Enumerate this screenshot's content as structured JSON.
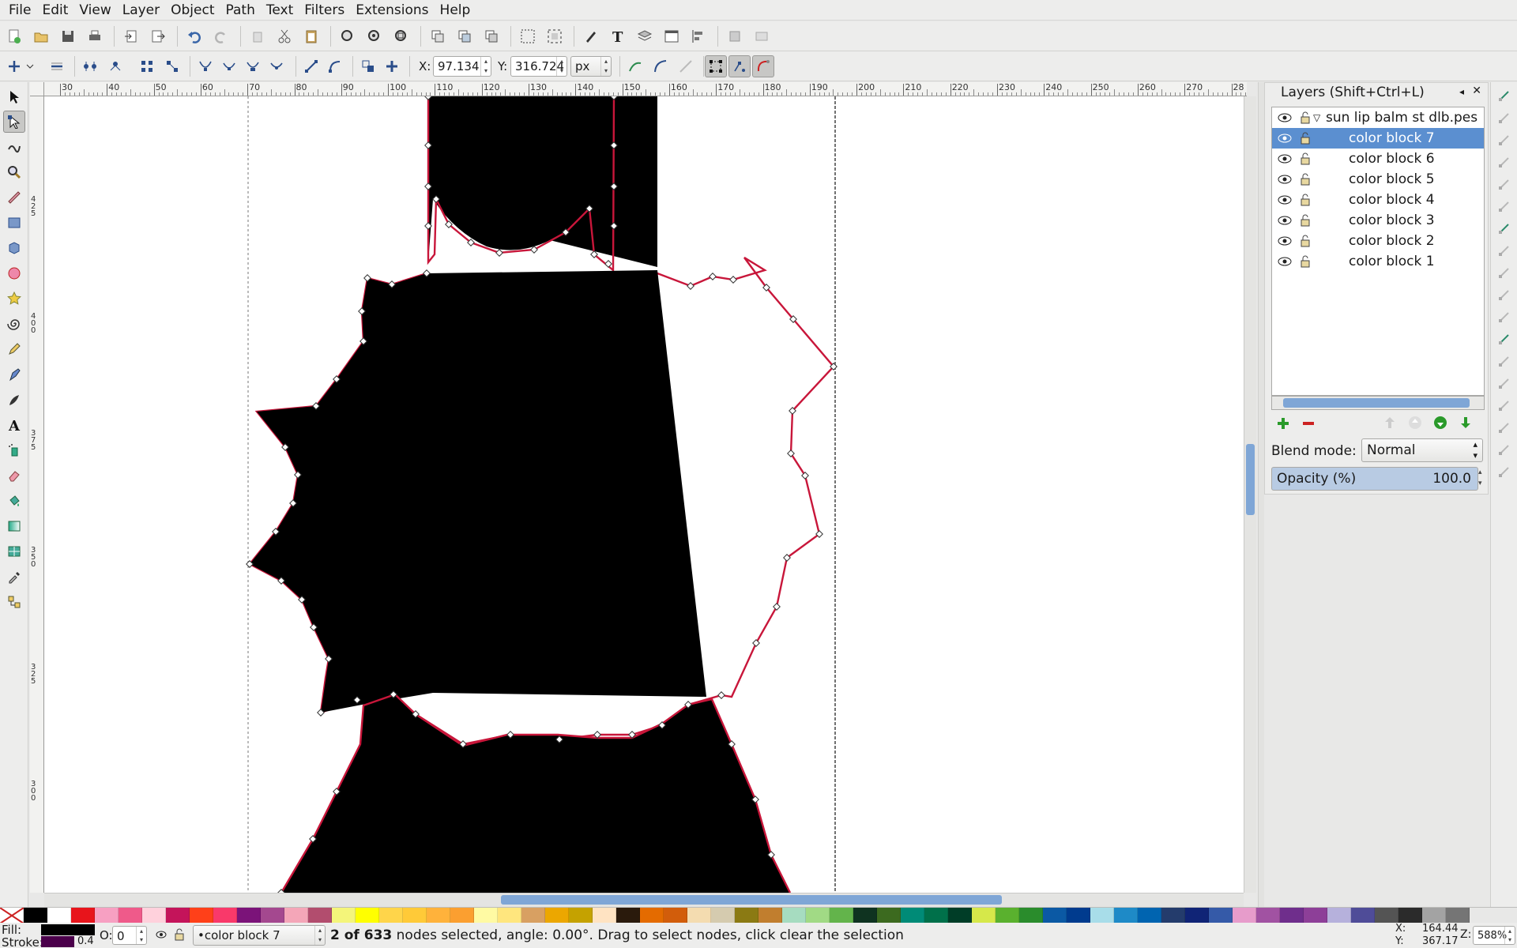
{
  "menubar": {
    "items": [
      "File",
      "Edit",
      "View",
      "Layer",
      "Object",
      "Path",
      "Text",
      "Filters",
      "Extensions",
      "Help"
    ]
  },
  "toolbar": {
    "x_label": "X:",
    "x_value": "97.134",
    "y_label": "Y:",
    "y_value": "316.724",
    "unit": "px"
  },
  "rulers": {
    "horizontal": [
      "30",
      "40",
      "50",
      "60",
      "70",
      "80",
      "90",
      "100",
      "110",
      "120",
      "130",
      "140",
      "150",
      "160",
      "170",
      "180",
      "190",
      "200",
      "210",
      "220",
      "230",
      "240",
      "250",
      "260",
      "270",
      "28"
    ],
    "vertical": [
      "425",
      "400",
      "375",
      "350",
      "325",
      "300"
    ]
  },
  "layers": {
    "title": "Layers (Shift+Ctrl+L)",
    "root": "sun lip balm st dlb.pes",
    "items": [
      "color block 7",
      "color block 6",
      "color block 5",
      "color block 4",
      "color block 3",
      "color block 2",
      "color block 1"
    ],
    "selected_index": 0,
    "blend_label": "Blend mode:",
    "blend_value": "Normal",
    "opacity_label": "Opacity (%)",
    "opacity_value": "100.0"
  },
  "palette": {
    "colors": [
      "#000000",
      "#ffffff",
      "#e8141b",
      "#f7a0c2",
      "#ef5a8a",
      "#ffd1dc",
      "#c4145a",
      "#ff4019",
      "#f9396a",
      "#7b1379",
      "#a4488f",
      "#f4a6b8",
      "#b24d6e",
      "#f4f57a",
      "#ffff00",
      "#ffd54a",
      "#ffca38",
      "#ffb23b",
      "#fb9f30",
      "#fffaa3",
      "#ffe67e",
      "#d8a062",
      "#eca700",
      "#c5a200",
      "#ffe3c2",
      "#2a1a0c",
      "#e46b00",
      "#d25d0b",
      "#f4dcb0",
      "#d5cbaf",
      "#8b7a13",
      "#c17e2e",
      "#a6dcc0",
      "#a1da85",
      "#63b44b",
      "#0f3320",
      "#3c6a1f",
      "#008b77",
      "#00704a",
      "#003d27",
      "#d6e84a",
      "#5ab12e",
      "#2a8c2c",
      "#0b59a4",
      "#003b8e",
      "#a8dde9",
      "#1e8ac7",
      "#0064b0",
      "#243c6c",
      "#102476",
      "#355aa8",
      "#e79ccb",
      "#a152a2",
      "#6f2e8c",
      "#8d3f98",
      "#b6b1dc",
      "#4f4c98",
      "#545454",
      "#2b2b2b",
      "#a3a3a3",
      "#757575"
    ],
    "stroke_label": "Stroke:"
  },
  "status": {
    "fill_label": "Fill:",
    "stroke_label": "Stroke:",
    "stroke_width": "0.4",
    "opacity_label": "O:",
    "opacity_value": "0",
    "layer_name": "•color block 7",
    "message_bold": "2 of 633",
    "message": " nodes selected, angle: 0.00°. Drag to select nodes, click clear the selection",
    "cursor_x_label": "X:",
    "cursor_x": "164.44",
    "cursor_y_label": "Y:",
    "cursor_y": "367.17",
    "zoom_label": "Z:",
    "zoom": "588%"
  }
}
